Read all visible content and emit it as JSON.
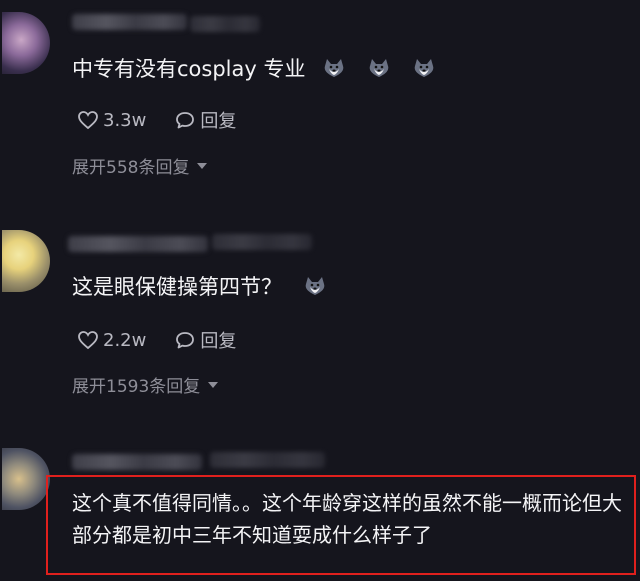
{
  "comments": [
    {
      "text": "中专有没有cosplay 专业",
      "likes": "3.3w",
      "reply_label": "回复",
      "expand_label": "展开558条回复",
      "emoji_icons": [
        "husky-emoji-icon",
        "husky-emoji-icon",
        "husky-emoji-icon"
      ]
    },
    {
      "text": "这是眼保健操第四节？",
      "likes": "2.2w",
      "reply_label": "回复",
      "expand_label": "展开1593条回复",
      "emoji_icons": [
        "husky-emoji-icon"
      ]
    },
    {
      "text": "这个真不值得同情。。这个年龄穿这样的虽然不能一概而论但大部分都是初中三年不知道耍成什么样子了"
    }
  ],
  "colors": {
    "background": "#15151d",
    "text": "#f4f4f6",
    "secondary_text": "#8e8e98",
    "highlight_border": "#e0201d"
  }
}
